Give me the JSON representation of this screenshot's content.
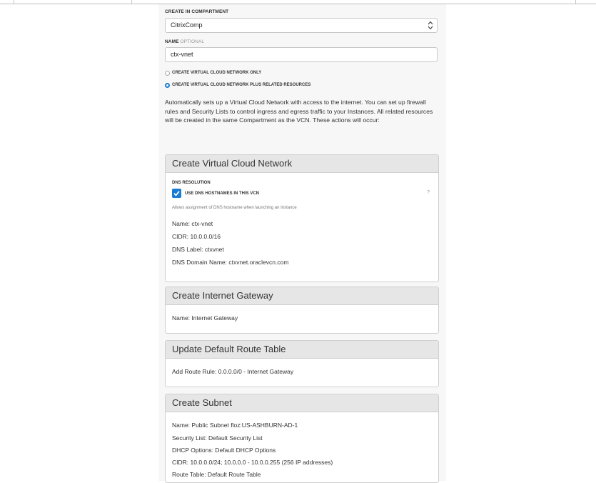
{
  "form": {
    "compartment_label": "CREATE IN COMPARTMENT",
    "compartment_value": "CitrixComp",
    "name_label": "NAME",
    "name_optional": "OPTIONAL",
    "name_value": "ctx-vnet",
    "radio_vcn_only": "CREATE VIRTUAL CLOUD NETWORK ONLY",
    "radio_vcn_plus": "CREATE VIRTUAL CLOUD NETWORK PLUS RELATED RESOURCES",
    "selected_option": "CREATE VIRTUAL CLOUD NETWORK PLUS RELATED RESOURCES",
    "description": "Automatically sets up a Virtual Cloud Network with access to the internet. You can set up firewall rules and Security Lists to control ingress and egress traffic to your Instances. All related resources will be created in the same Compartment as the VCN. These actions will occur:"
  },
  "vcn_card": {
    "title": "Create Virtual Cloud Network",
    "dns_resolution_label": "DNS RESOLUTION",
    "dns_checkbox_label": "USE DNS HOSTNAMES IN THIS VCN",
    "dns_checked": true,
    "help_mark": "?",
    "hint": "Allows assignment of DNS hostname when launching an Instance",
    "name": "Name: ctx-vnet",
    "cidr": "CIDR: 10.0.0.0/16",
    "dns_label": "DNS Label: ctxvnet",
    "dns_domain": "DNS Domain Name: ctxvnet.oraclevcn.com"
  },
  "igw_card": {
    "title": "Create Internet Gateway",
    "name": "Name: Internet Gateway"
  },
  "route_card": {
    "title": "Update Default Route Table",
    "rule": "Add Route Rule: 0.0.0.0/0 - Internet Gateway"
  },
  "subnet_card": {
    "title": "Create Subnet",
    "name": "Name: Public Subnet floz:US-ASHBURN-AD-1",
    "security_list": "Security List: Default Security List",
    "dhcp": "DHCP Options: Default DHCP Options",
    "cidr": "CIDR: 10.0.0.0/24; 10.0.0.0 - 10.0.0.255 (256 IP addresses)",
    "route_table": "Route Table: Default Route Table"
  },
  "colors": {
    "accent": "#1a7bd5",
    "card_header": "#e6e6e6",
    "panel_bg": "#f7f7f7"
  }
}
